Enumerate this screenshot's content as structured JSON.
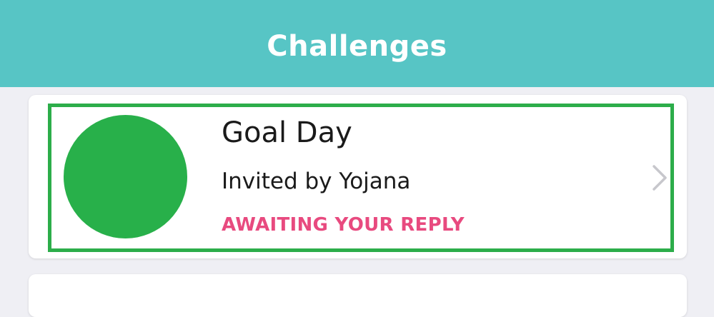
{
  "header": {
    "title": "Challenges"
  },
  "challenges": [
    {
      "name": "Goal Day",
      "invited_by": "Invited by Yojana",
      "status": "AWAITING YOUR REPLY",
      "avatar_color": "#28b04a",
      "status_color": "#e84a7f",
      "icon": "chevron-right-icon"
    }
  ],
  "colors": {
    "header_bg": "#57c5c5",
    "highlight_border": "#2cad4a",
    "page_bg": "#efeff4"
  }
}
